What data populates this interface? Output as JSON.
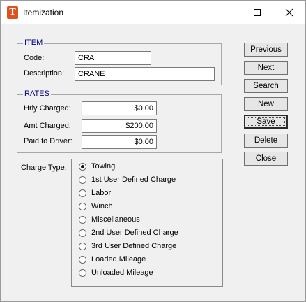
{
  "window": {
    "title": "Itemization",
    "app_icon_letter": "T"
  },
  "item": {
    "legend": "ITEM",
    "code_label": "Code:",
    "code_value": "CRA",
    "description_label": "Description:",
    "description_value": "CRANE"
  },
  "rates": {
    "legend": "RATES",
    "hrly_label": "Hrly Charged:",
    "hrly_value": "$0.00",
    "amt_label": "Amt Charged:",
    "amt_value": "$200.00",
    "paid_label": "Paid to Driver:",
    "paid_value": "$0.00"
  },
  "charge_type": {
    "label": "Charge Type:",
    "selected": "Towing",
    "options": [
      "Towing",
      "1st User Defined Charge",
      "Labor",
      "Winch",
      "Miscellaneous",
      "2nd User Defined Charge",
      "3rd User Defined Charge",
      "Loaded Mileage",
      "Unloaded Mileage"
    ]
  },
  "buttons": {
    "previous": "Previous",
    "next": "Next",
    "search": "Search",
    "new": "New",
    "save": "Save",
    "delete": "Delete",
    "close": "Close"
  }
}
